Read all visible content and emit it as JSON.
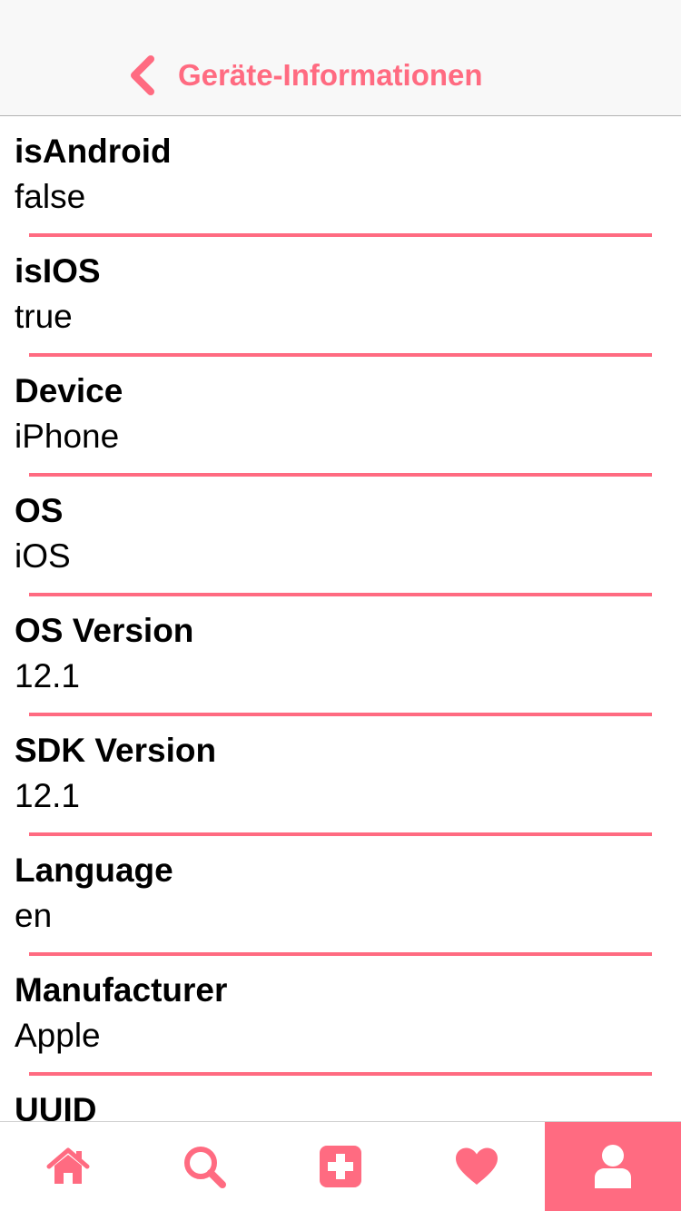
{
  "nav": {
    "title": "Geräte-Informationen",
    "back_icon": "chevron-left-icon"
  },
  "colors": {
    "accent": "#ff6b81",
    "text": "#000000",
    "nav_background": "#f8f8f8"
  },
  "rows": [
    {
      "label": "isAndroid",
      "value": "false"
    },
    {
      "label": "isIOS",
      "value": "true"
    },
    {
      "label": "Device",
      "value": "iPhone"
    },
    {
      "label": "OS",
      "value": "iOS"
    },
    {
      "label": "OS Version",
      "value": "12.1"
    },
    {
      "label": "SDK Version",
      "value": "12.1"
    },
    {
      "label": "Language",
      "value": "en"
    },
    {
      "label": "Manufacturer",
      "value": "Apple"
    },
    {
      "label": "UUID",
      "value": ""
    }
  ],
  "tabs": [
    {
      "icon": "home-icon",
      "active": false
    },
    {
      "icon": "search-icon",
      "active": false
    },
    {
      "icon": "add-icon",
      "active": false
    },
    {
      "icon": "heart-icon",
      "active": false
    },
    {
      "icon": "user-icon",
      "active": true
    }
  ]
}
